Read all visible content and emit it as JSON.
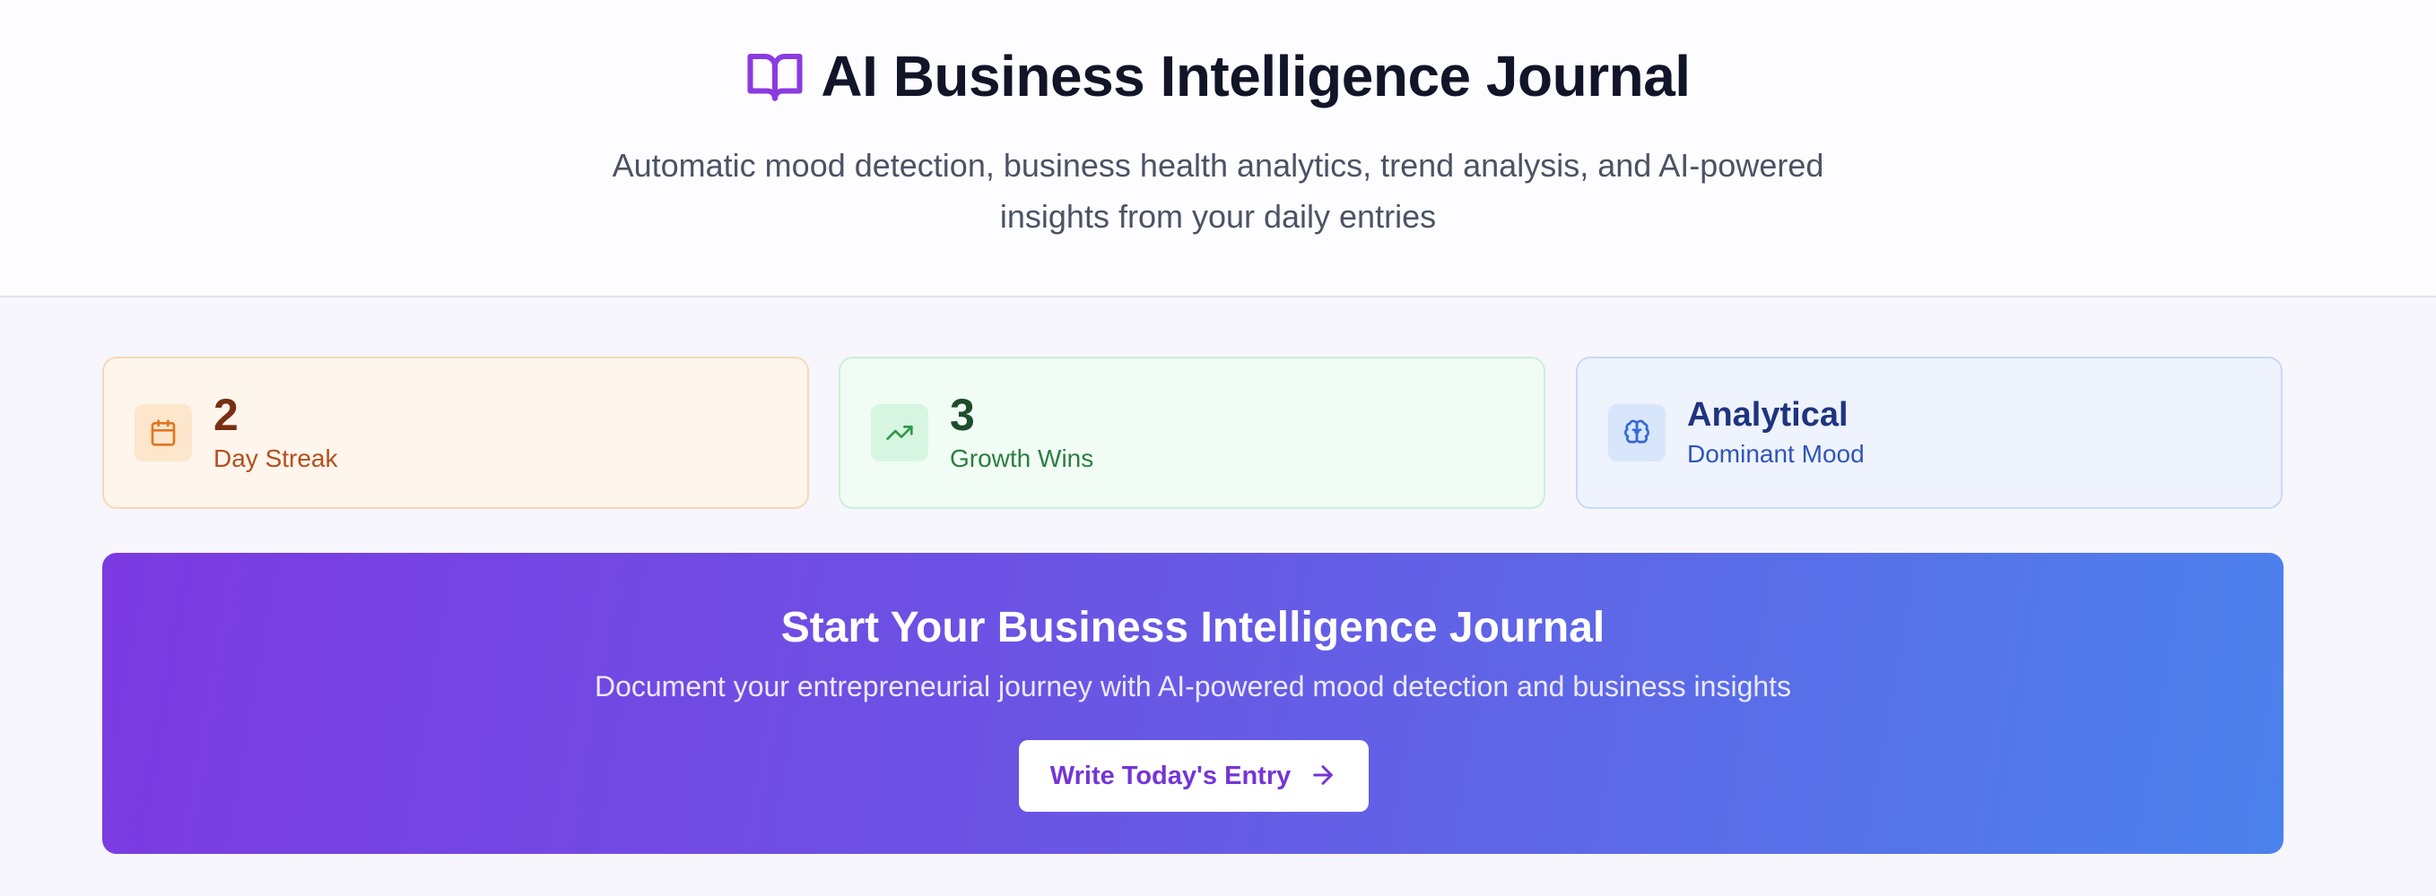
{
  "header": {
    "icon": "book-open-icon",
    "title": "AI Business Intelligence Journal",
    "subtitle": "Automatic mood detection, business health analytics, trend analysis, and AI-powered insights from your daily entries"
  },
  "stats": [
    {
      "icon": "calendar-icon",
      "value": "2",
      "label": "Day Streak"
    },
    {
      "icon": "trending-up-icon",
      "value": "3",
      "label": "Growth Wins"
    },
    {
      "icon": "brain-icon",
      "value": "Analytical",
      "label": "Dominant Mood"
    }
  ],
  "hero": {
    "title": "Start Your Business Intelligence Journal",
    "subtitle": "Document your entrepreneurial journey with AI-powered mood detection and business insights",
    "button_label": "Write Today's Entry",
    "button_icon": "arrow-right-icon"
  },
  "colors": {
    "accent": "#7c3ae2",
    "gradient_end": "#4c82ec",
    "streak": "#b4501c",
    "wins": "#2e7d41",
    "mood": "#2f55b9"
  }
}
